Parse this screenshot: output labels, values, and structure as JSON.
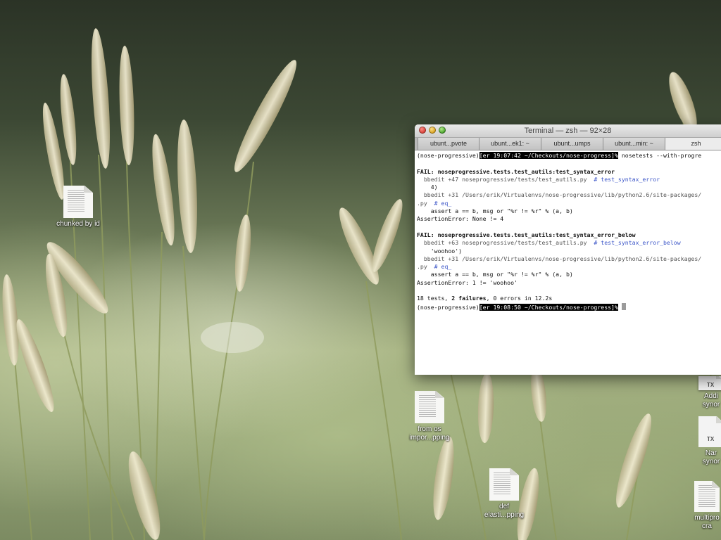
{
  "desktop_icons": [
    {
      "label_lines": [
        "chunked by id"
      ],
      "kind": "document"
    },
    {
      "label_lines": [
        "from os",
        "impor...pping"
      ],
      "kind": "document"
    },
    {
      "label_lines": [
        "def",
        "elasti...pping"
      ],
      "kind": "document"
    },
    {
      "label_lines": [
        "Addi",
        "synor"
      ],
      "kind": "txt",
      "badge": "TX"
    },
    {
      "label_lines": [
        "Nar",
        "synor"
      ],
      "kind": "txt",
      "badge": "TX"
    },
    {
      "label_lines": [
        "multipro",
        "cra"
      ],
      "kind": "document"
    }
  ],
  "terminal": {
    "title": "Terminal — zsh — 92×28",
    "tabs": [
      "ubunt...pvote",
      "ubunt...ek1: ~",
      "ubunt...umps",
      "ubunt...min: ~",
      "zsh"
    ],
    "active_tab": 4,
    "lines": [
      {
        "parts": [
          {
            "t": "(nose-progressive)"
          },
          {
            "t": "[er 19:07:42 ~/Checkouts/nose-progress]%",
            "s": "hl"
          },
          {
            "t": " nosetests --with-progre"
          }
        ]
      },
      {
        "parts": [
          {
            "t": ""
          }
        ]
      },
      {
        "parts": [
          {
            "t": "FAIL: noseprogressive.tests.test_autils:test_syntax_error",
            "s": "bold"
          }
        ]
      },
      {
        "parts": [
          {
            "t": "  bbedit +47 ",
            "s": "gray"
          },
          {
            "t": "noseprogressive/tests/test_autils.py",
            "s": "gray"
          },
          {
            "t": "  # test_syntax_error",
            "s": "blue"
          }
        ]
      },
      {
        "parts": [
          {
            "t": "    4)"
          }
        ]
      },
      {
        "parts": [
          {
            "t": "  bbedit +31 ",
            "s": "gray"
          },
          {
            "t": "/Users/erik/Virtualenvs/nose-progressive/lib/python2.6/site-packages/",
            "s": "gray"
          }
        ]
      },
      {
        "parts": [
          {
            "t": ".py",
            "s": "gray"
          },
          {
            "t": "  # eq_",
            "s": "blue"
          }
        ]
      },
      {
        "parts": [
          {
            "t": "    assert a == b, msg or \"%r != %r\" % (a, b)"
          }
        ]
      },
      {
        "parts": [
          {
            "t": "AssertionError: None != 4"
          }
        ]
      },
      {
        "parts": [
          {
            "t": ""
          }
        ]
      },
      {
        "parts": [
          {
            "t": "FAIL: noseprogressive.tests.test_autils:test_syntax_error_below",
            "s": "bold"
          }
        ]
      },
      {
        "parts": [
          {
            "t": "  bbedit +63 ",
            "s": "gray"
          },
          {
            "t": "noseprogressive/tests/test_autils.py",
            "s": "gray"
          },
          {
            "t": "  # test_syntax_error_below",
            "s": "blue"
          }
        ]
      },
      {
        "parts": [
          {
            "t": "    'woohoo')"
          }
        ]
      },
      {
        "parts": [
          {
            "t": "  bbedit +31 ",
            "s": "gray"
          },
          {
            "t": "/Users/erik/Virtualenvs/nose-progressive/lib/python2.6/site-packages/",
            "s": "gray"
          }
        ]
      },
      {
        "parts": [
          {
            "t": ".py",
            "s": "gray"
          },
          {
            "t": "  # eq_",
            "s": "blue"
          }
        ]
      },
      {
        "parts": [
          {
            "t": "    assert a == b, msg or \"%r != %r\" % (a, b)"
          }
        ]
      },
      {
        "parts": [
          {
            "t": "AssertionError: 1 != 'woohoo'"
          }
        ]
      },
      {
        "parts": [
          {
            "t": ""
          }
        ]
      },
      {
        "parts": [
          {
            "t": "18 tests, "
          },
          {
            "t": "2 failures",
            "s": "bold"
          },
          {
            "t": ", 0 errors in 12.2s"
          }
        ]
      },
      {
        "parts": [
          {
            "t": "(nose-progressive)"
          },
          {
            "t": "[er 19:08:50 ~/Checkouts/nose-progress]%",
            "s": "hl"
          },
          {
            "t": " "
          },
          {
            "t": "",
            "s": "cursor"
          }
        ]
      }
    ]
  }
}
